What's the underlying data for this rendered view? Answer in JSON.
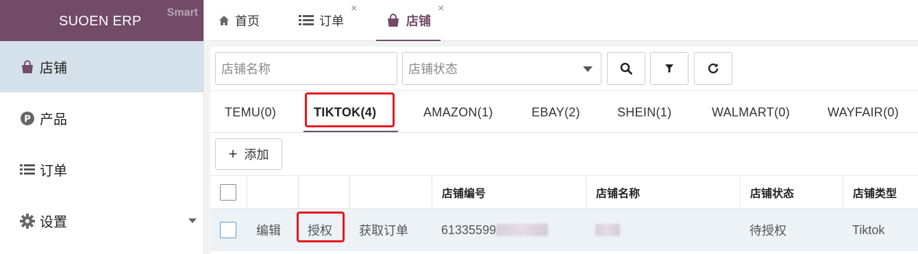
{
  "brand": {
    "name": "SUOEN ERP",
    "tag": "Smart"
  },
  "sidebar": {
    "items": [
      {
        "label": "店铺",
        "icon": "bag-icon"
      },
      {
        "label": "产品",
        "icon": "p-circle-icon"
      },
      {
        "label": "订单",
        "icon": "list-icon"
      },
      {
        "label": "设置",
        "icon": "gear-icon"
      }
    ]
  },
  "tabs": [
    {
      "label": "首页",
      "icon": "home-icon"
    },
    {
      "label": "订单",
      "icon": "list-icon",
      "close": "×"
    },
    {
      "label": "店铺",
      "icon": "bag-icon",
      "close": "×"
    }
  ],
  "filters": {
    "store_name_placeholder": "店铺名称",
    "store_status_placeholder": "店铺状态"
  },
  "platform_tabs": [
    "TEMU(0)",
    "TIKTOK(4)",
    "AMAZON(1)",
    "EBAY(2)",
    "SHEIN(1)",
    "WALMART(0)",
    "WAYFAIR(0)"
  ],
  "actions": {
    "add_label": "添加"
  },
  "table": {
    "columns": [
      "店铺编号",
      "店铺名称",
      "店铺状态",
      "店铺类型"
    ],
    "rows": [
      {
        "edit": "编辑",
        "authorize": "授权",
        "fetch_orders": "获取订单",
        "store_id": "61335599",
        "store_status": "待授权",
        "store_type": "Tiktok"
      }
    ]
  },
  "colors": {
    "brand": "#714b67",
    "highlight": "#e8141b",
    "active_sidebar": "#d5e1ea"
  }
}
